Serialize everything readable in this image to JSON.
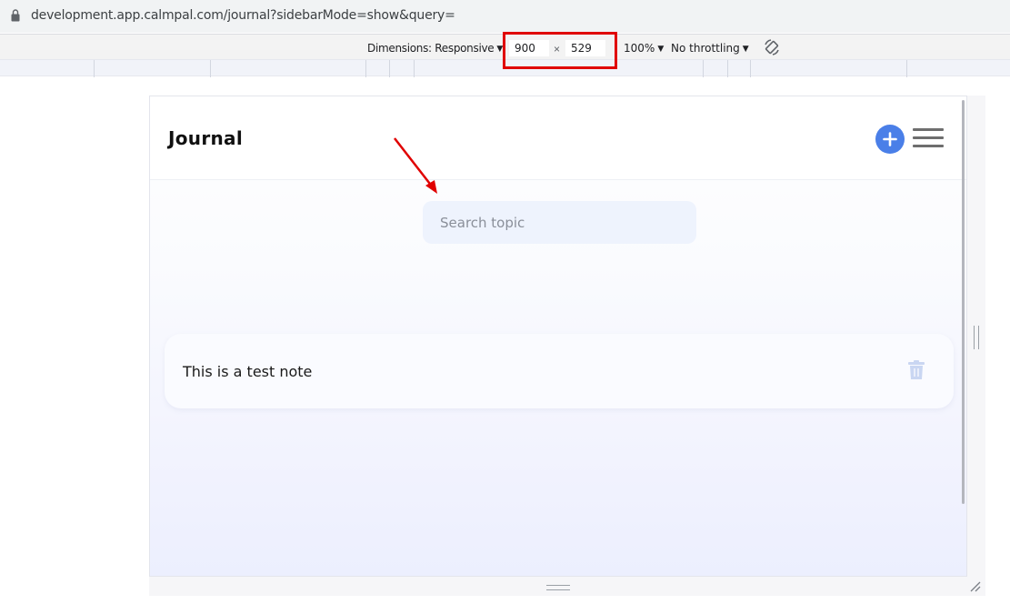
{
  "browser": {
    "url": "development.app.calmpal.com/journal?sidebarMode=show&query="
  },
  "devtools": {
    "dimensions_label": "Dimensions: Responsive",
    "width_value": "900",
    "times_symbol": "×",
    "height_value": "529",
    "zoom_label": "100%",
    "throttle_label": "No throttling",
    "caret": "▼"
  },
  "app": {
    "title": "Journal",
    "search": {
      "placeholder": "Search topic",
      "value": ""
    },
    "notes": [
      {
        "title": "This is a test note"
      }
    ]
  },
  "icons": {
    "lock": "lock-icon",
    "rotate": "rotate-icon",
    "add": "plus-icon",
    "menu": "hamburger-menu-icon",
    "delete": "trash-icon"
  },
  "colors": {
    "accent": "#4a7fe8",
    "search_bg": "#eef3fd",
    "annotation": "#e00000",
    "trash": "#c9d6f2"
  }
}
